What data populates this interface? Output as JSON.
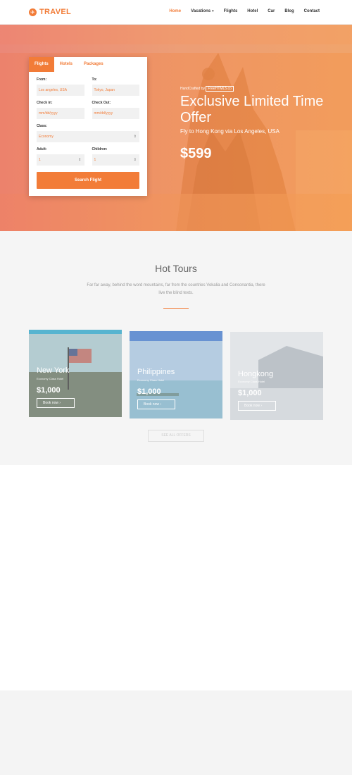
{
  "header": {
    "logo_text": "TRAVEL",
    "nav": [
      {
        "label": "Home",
        "active": true
      },
      {
        "label": "Vacations",
        "dropdown": true
      },
      {
        "label": "Flights"
      },
      {
        "label": "Hotel"
      },
      {
        "label": "Car"
      },
      {
        "label": "Blog"
      },
      {
        "label": "Contact"
      }
    ]
  },
  "search": {
    "tabs": [
      "Flights",
      "Hotels",
      "Packages"
    ],
    "from_label": "From:",
    "from_value": "Los angeles, USA",
    "to_label": "To:",
    "to_value": "Tokyo, Japan",
    "checkin_label": "Check in:",
    "checkin_placeholder": "mm/dd/yyyy",
    "checkout_label": "Check Out:",
    "checkout_placeholder": "mm/dd/yyyy",
    "class_label": "Class:",
    "class_value": "Economy",
    "adult_label": "Adult:",
    "adult_value": "1",
    "children_label": "Children:",
    "children_value": "1",
    "button": "Search Flight"
  },
  "hero": {
    "crafted_prefix": "HandCrafted by",
    "crafted_brand": "FreeHTML5.co",
    "title": "Exclusive Limited Time Offer",
    "subtitle": "Fly to Hong Kong via Los Angeles, USA",
    "price": "$599"
  },
  "tours": {
    "title": "Hot Tours",
    "description": "Far far away, behind the word mountains, far from the countries Vokalia and Consonantia, there live the blind texts.",
    "cards": [
      {
        "name": "New York",
        "meta": "Economy Class Hotel",
        "price": "$1,000",
        "button": "Book now",
        "colors": [
          "#6aa8c6",
          "#8ea59a",
          "#5e6b5a"
        ]
      },
      {
        "name": "Philippines",
        "meta": "Economy Class Hotel",
        "price": "$1,000",
        "button": "Book now",
        "colors": [
          "#4f7fc8",
          "#8fb1d6",
          "#a1c2d3"
        ]
      },
      {
        "name": "Hongkong",
        "meta": "Economy Class Hotel",
        "price": "$1,000",
        "button": "Book now",
        "colors": [
          "#c3ccd3",
          "#9ea8b1",
          "#b7bec4"
        ]
      }
    ],
    "view_all": "SEE ALL OFFERS"
  }
}
